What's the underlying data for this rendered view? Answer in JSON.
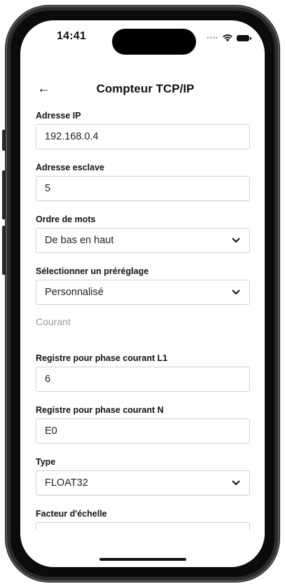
{
  "status_bar": {
    "time": "14:41",
    "signal_icon": "signal-dots-icon",
    "wifi_icon": "wifi-icon",
    "battery_icon": "battery-icon"
  },
  "header": {
    "back_icon": "arrow-left-icon",
    "title": "Compteur TCP/IP"
  },
  "form": {
    "ip_address": {
      "label": "Adresse IP",
      "value": "192.168.0.4"
    },
    "slave_address": {
      "label": "Adresse esclave",
      "value": "5"
    },
    "word_order": {
      "label": "Ordre de mots",
      "value": "De bas en haut"
    },
    "preset": {
      "label": "Sélectionner un préréglage",
      "value": "Personnalisé"
    },
    "current_section": {
      "title": "Courant"
    },
    "register_l1": {
      "label": "Registre pour phase courant L1",
      "value": "6"
    },
    "register_n": {
      "label": "Registre pour phase courant N",
      "value": "E0"
    },
    "type": {
      "label": "Type",
      "value": "FLOAT32"
    },
    "scale_factor": {
      "label": "Facteur d'échelle",
      "value": ""
    }
  }
}
